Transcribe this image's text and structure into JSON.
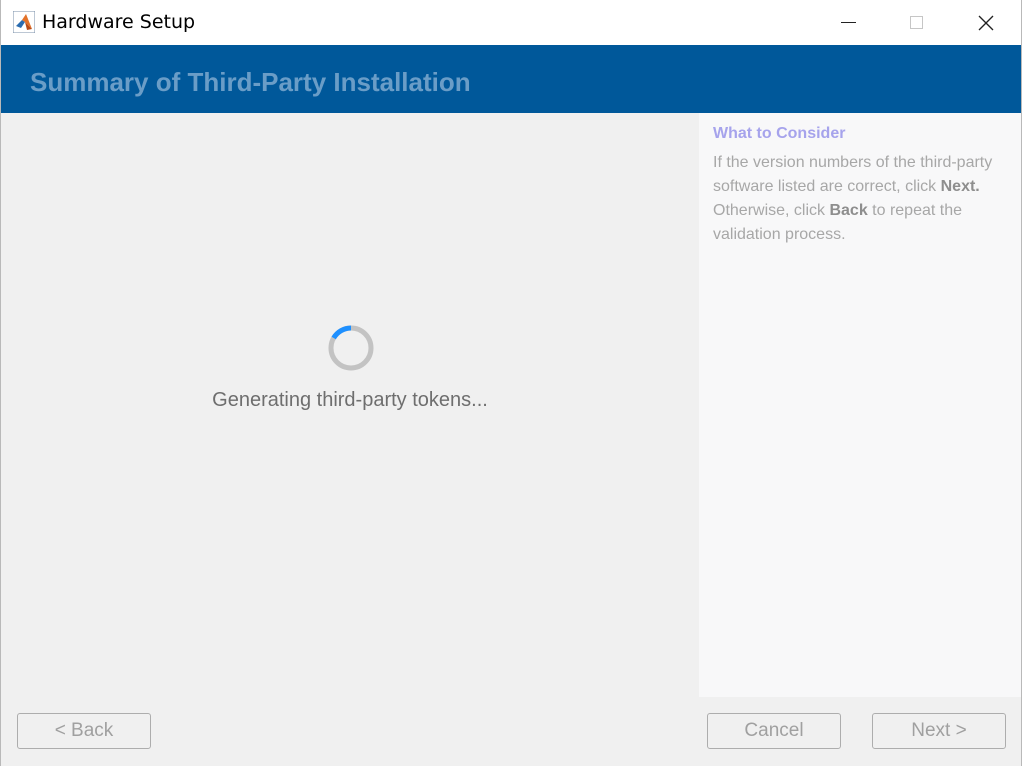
{
  "window": {
    "title": "Hardware Setup",
    "icon": "matlab-logo-icon"
  },
  "banner": {
    "title": "Summary of Third-Party Installation"
  },
  "content": {
    "status": "Generating third-party tokens..."
  },
  "help": {
    "title": "What to Consider",
    "text_1": "If the version numbers of the third-party software listed are correct, click ",
    "bold_next": "Next.",
    "text_2": " Otherwise, click ",
    "bold_back": "Back",
    "text_3": " to repeat the validation process."
  },
  "footer": {
    "back_label": "< Back",
    "cancel_label": "Cancel",
    "next_label": "Next >"
  },
  "colors": {
    "banner": "#00589a",
    "banner_title": "#6a9dc7",
    "spinner_accent": "#1e90ff"
  }
}
